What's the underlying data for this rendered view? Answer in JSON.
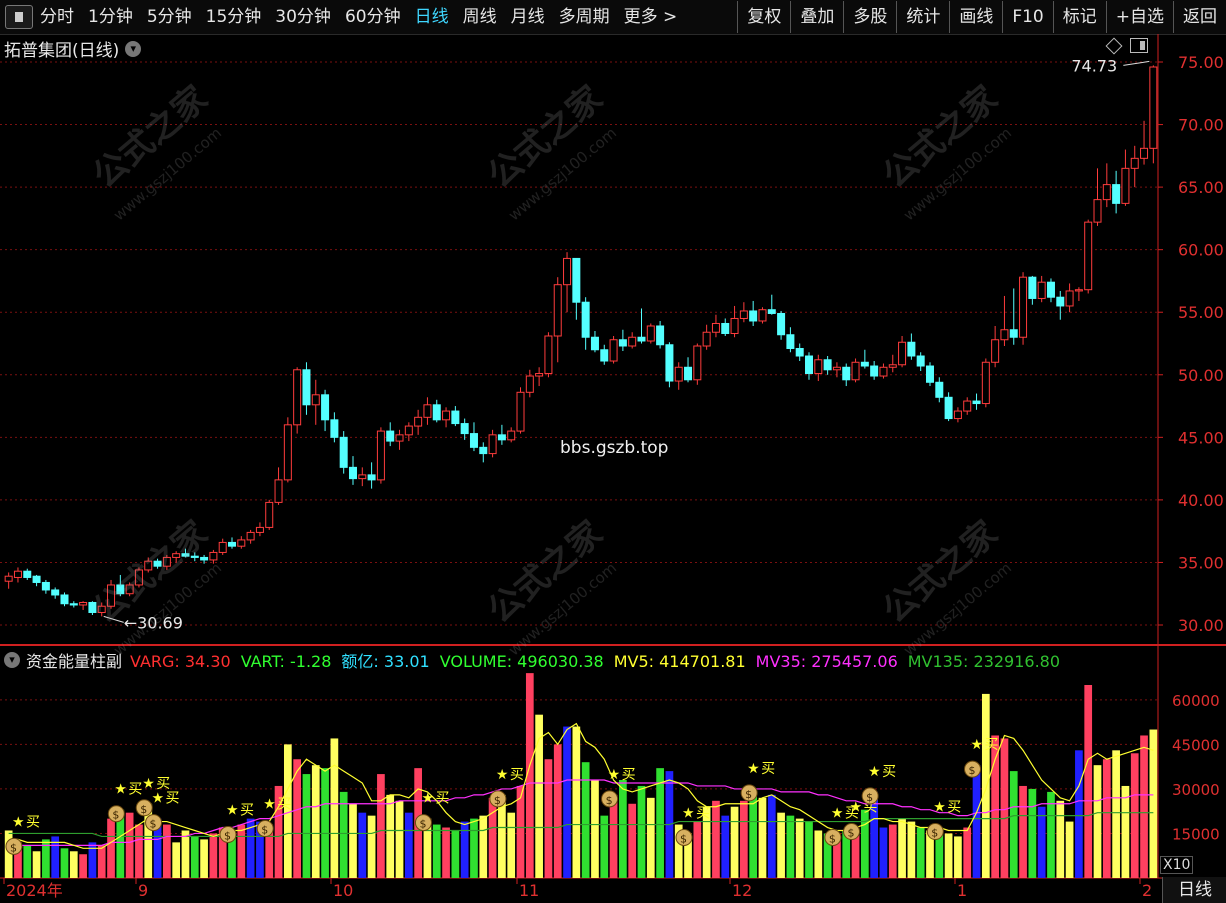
{
  "toolbar": {
    "period_items": [
      "分时",
      "1分钟",
      "5分钟",
      "15分钟",
      "30分钟",
      "60分钟",
      "日线",
      "周线",
      "月线",
      "多周期",
      "更多 >"
    ],
    "active_index": 6,
    "right_buttons": [
      "复权",
      "叠加",
      "多股",
      "统计",
      "画线",
      "F10",
      "标记",
      "+自选",
      "返回"
    ]
  },
  "main_title": "拓普集团(日线)",
  "price_axis": {
    "labels": [
      "75.00",
      "70.00",
      "65.00",
      "60.00",
      "55.00",
      "50.00",
      "45.00",
      "40.00",
      "35.00",
      "30.00"
    ],
    "min": 30,
    "max": 75
  },
  "annotations": {
    "high": "74.73",
    "low": "30.69"
  },
  "overlay_text": "bbs.gszb.top",
  "watermark": {
    "cn": "公式之家",
    "url": "www.gszj100.com"
  },
  "sub_title": {
    "name": "资金能量柱副",
    "items": [
      {
        "label": "VARG: ",
        "value": "34.30",
        "color": "#ff3030"
      },
      {
        "label": "VART: ",
        "value": "-1.28",
        "color": "#30ff30"
      },
      {
        "label": "额亿: ",
        "value": "33.01",
        "color": "#30e0ff"
      },
      {
        "label": "VOLUME: ",
        "value": "496030.38",
        "color": "#30ff30"
      },
      {
        "label": "MV5: ",
        "value": "414701.81",
        "color": "#ffff30"
      },
      {
        "label": "MV35: ",
        "value": "275457.06",
        "color": "#ff30ff"
      },
      {
        "label": "MV135: ",
        "value": "232916.80",
        "color": "#30c030"
      }
    ]
  },
  "volume_axis": {
    "labels": [
      "60000",
      "45000",
      "30000",
      "15000"
    ],
    "max": 65000
  },
  "x_axis": {
    "labels": [
      "2024年",
      "9",
      "10",
      "11",
      "12",
      "1",
      "2"
    ]
  },
  "multiplier": "X10",
  "period_tab": "日线",
  "buy_label": "买",
  "colors": {
    "up": "#ff3c3c",
    "down": "#54ffff",
    "grid": "#7a1010",
    "axis": "#d02020"
  },
  "chart_data": {
    "type": "candlestick+bar",
    "candles": [
      [
        33.5,
        34.2,
        32.9,
        33.9
      ],
      [
        33.8,
        34.6,
        33.4,
        34.3
      ],
      [
        34.3,
        34.5,
        33.6,
        33.8
      ],
      [
        33.9,
        34.0,
        33.1,
        33.4
      ],
      [
        33.4,
        33.6,
        32.5,
        32.8
      ],
      [
        32.8,
        33.0,
        32.1,
        32.4
      ],
      [
        32.4,
        32.6,
        31.5,
        31.7
      ],
      [
        31.7,
        31.9,
        31.4,
        31.6
      ],
      [
        31.6,
        31.9,
        31.2,
        31.8
      ],
      [
        31.8,
        31.9,
        30.8,
        31.0
      ],
      [
        31.0,
        31.8,
        30.69,
        31.5
      ],
      [
        31.5,
        33.6,
        31.3,
        33.2
      ],
      [
        33.2,
        34.0,
        32.3,
        32.5
      ],
      [
        32.5,
        33.4,
        32.3,
        33.2
      ],
      [
        33.2,
        34.6,
        33.0,
        34.4
      ],
      [
        34.4,
        35.4,
        34.2,
        35.1
      ],
      [
        35.1,
        35.3,
        34.5,
        34.7
      ],
      [
        34.7,
        35.6,
        34.4,
        35.4
      ],
      [
        35.4,
        35.9,
        35.0,
        35.7
      ],
      [
        35.7,
        36.1,
        35.4,
        35.5
      ],
      [
        35.5,
        35.8,
        35.1,
        35.4
      ],
      [
        35.4,
        35.6,
        34.9,
        35.2
      ],
      [
        35.2,
        36.0,
        34.9,
        35.8
      ],
      [
        35.8,
        36.9,
        35.6,
        36.6
      ],
      [
        36.6,
        37.0,
        36.1,
        36.3
      ],
      [
        36.3,
        37.1,
        36.1,
        36.8
      ],
      [
        36.8,
        37.6,
        36.5,
        37.4
      ],
      [
        37.4,
        38.2,
        37.1,
        37.8
      ],
      [
        37.8,
        40.0,
        37.6,
        39.8
      ],
      [
        39.8,
        42.6,
        39.6,
        41.6
      ],
      [
        41.6,
        46.6,
        41.4,
        46.0
      ],
      [
        46.0,
        50.6,
        45.3,
        50.4
      ],
      [
        50.4,
        51.0,
        46.8,
        47.6
      ],
      [
        47.6,
        49.6,
        46.0,
        48.4
      ],
      [
        48.4,
        48.8,
        45.5,
        46.4
      ],
      [
        46.4,
        47.0,
        44.6,
        45.0
      ],
      [
        45.0,
        45.5,
        42.1,
        42.6
      ],
      [
        42.6,
        43.5,
        41.2,
        41.7
      ],
      [
        41.7,
        42.6,
        41.1,
        42.0
      ],
      [
        42.0,
        43.0,
        40.9,
        41.6
      ],
      [
        41.6,
        45.8,
        41.3,
        45.5
      ],
      [
        45.5,
        46.2,
        44.3,
        44.7
      ],
      [
        44.7,
        45.6,
        44.0,
        45.2
      ],
      [
        45.2,
        46.2,
        44.7,
        45.9
      ],
      [
        45.9,
        47.2,
        45.2,
        46.6
      ],
      [
        46.6,
        48.2,
        46.0,
        47.6
      ],
      [
        47.6,
        48.0,
        46.2,
        46.4
      ],
      [
        46.4,
        47.4,
        45.8,
        47.1
      ],
      [
        47.1,
        47.5,
        45.9,
        46.1
      ],
      [
        46.1,
        46.5,
        44.8,
        45.3
      ],
      [
        45.3,
        46.2,
        43.9,
        44.2
      ],
      [
        44.2,
        44.6,
        43.0,
        43.7
      ],
      [
        43.7,
        45.6,
        43.4,
        45.2
      ],
      [
        45.2,
        46.0,
        44.4,
        44.8
      ],
      [
        44.8,
        45.8,
        44.6,
        45.5
      ],
      [
        45.5,
        49.0,
        45.3,
        48.6
      ],
      [
        48.6,
        50.4,
        48.2,
        49.9
      ],
      [
        49.9,
        50.6,
        49.1,
        50.1
      ],
      [
        50.1,
        53.4,
        49.8,
        53.1
      ],
      [
        53.1,
        57.8,
        51.0,
        57.2
      ],
      [
        57.2,
        59.8,
        55.0,
        59.3
      ],
      [
        59.3,
        57.1,
        54.4,
        55.8
      ],
      [
        55.8,
        56.2,
        52.0,
        53.0
      ],
      [
        53.0,
        53.5,
        51.8,
        52.0
      ],
      [
        52.0,
        52.4,
        50.8,
        51.1
      ],
      [
        51.1,
        53.1,
        50.9,
        52.8
      ],
      [
        52.8,
        53.6,
        51.9,
        52.3
      ],
      [
        52.3,
        53.4,
        52.1,
        53.0
      ],
      [
        53.0,
        55.3,
        52.5,
        52.7
      ],
      [
        52.7,
        54.1,
        52.5,
        53.9
      ],
      [
        53.9,
        54.3,
        52.1,
        52.4
      ],
      [
        52.4,
        52.6,
        49.0,
        49.5
      ],
      [
        49.5,
        51.0,
        48.8,
        50.6
      ],
      [
        50.6,
        51.4,
        49.4,
        49.6
      ],
      [
        49.6,
        52.5,
        49.2,
        52.3
      ],
      [
        52.3,
        54.0,
        52.0,
        53.4
      ],
      [
        53.4,
        54.8,
        53.0,
        54.1
      ],
      [
        54.1,
        54.5,
        53.1,
        53.3
      ],
      [
        53.3,
        55.5,
        53.0,
        54.5
      ],
      [
        54.5,
        55.8,
        54.2,
        55.1
      ],
      [
        55.1,
        55.9,
        53.9,
        54.3
      ],
      [
        54.3,
        55.4,
        54.1,
        55.2
      ],
      [
        55.2,
        56.4,
        54.8,
        54.9
      ],
      [
        54.9,
        55.1,
        52.8,
        53.2
      ],
      [
        53.2,
        53.8,
        51.8,
        52.1
      ],
      [
        52.1,
        52.5,
        51.1,
        51.5
      ],
      [
        51.5,
        51.8,
        49.6,
        50.1
      ],
      [
        50.1,
        51.6,
        49.5,
        51.2
      ],
      [
        51.2,
        51.5,
        50.0,
        50.4
      ],
      [
        50.4,
        51.0,
        49.8,
        50.6
      ],
      [
        50.6,
        50.9,
        49.1,
        49.6
      ],
      [
        49.6,
        51.3,
        49.4,
        51.0
      ],
      [
        51.0,
        52.0,
        50.5,
        50.7
      ],
      [
        50.7,
        51.1,
        49.6,
        49.9
      ],
      [
        49.9,
        50.9,
        49.7,
        50.6
      ],
      [
        50.6,
        51.6,
        50.2,
        50.8
      ],
      [
        50.8,
        53.1,
        50.6,
        52.6
      ],
      [
        52.6,
        53.3,
        51.2,
        51.5
      ],
      [
        51.5,
        51.8,
        50.3,
        50.7
      ],
      [
        50.7,
        51.0,
        49.1,
        49.4
      ],
      [
        49.4,
        49.8,
        47.8,
        48.2
      ],
      [
        48.2,
        48.6,
        46.3,
        46.5
      ],
      [
        46.5,
        47.4,
        46.2,
        47.1
      ],
      [
        47.1,
        48.2,
        46.8,
        47.9
      ],
      [
        47.9,
        48.5,
        47.2,
        47.7
      ],
      [
        47.7,
        51.3,
        47.4,
        51.0
      ],
      [
        51.0,
        53.9,
        50.6,
        52.8
      ],
      [
        52.8,
        56.3,
        52.3,
        53.6
      ],
      [
        53.6,
        56.9,
        52.4,
        53.0
      ],
      [
        53.0,
        58.2,
        52.4,
        57.8
      ],
      [
        57.8,
        57.9,
        55.6,
        56.1
      ],
      [
        56.1,
        57.9,
        55.8,
        57.4
      ],
      [
        57.4,
        57.7,
        55.8,
        56.2
      ],
      [
        56.2,
        56.7,
        54.4,
        55.5
      ],
      [
        55.5,
        57.3,
        55.0,
        56.7
      ],
      [
        56.7,
        57.0,
        55.9,
        56.8
      ],
      [
        56.8,
        62.4,
        56.5,
        62.2
      ],
      [
        62.2,
        66.5,
        61.9,
        64.0
      ],
      [
        64.0,
        66.9,
        63.4,
        65.2
      ],
      [
        65.2,
        66.3,
        62.9,
        63.7
      ],
      [
        63.7,
        68.0,
        63.5,
        66.5
      ],
      [
        66.5,
        68.3,
        65.0,
        67.3
      ],
      [
        67.3,
        70.3,
        66.8,
        68.1
      ],
      [
        68.1,
        74.73,
        66.9,
        74.6
      ]
    ],
    "volumes": [
      16,
      12,
      11,
      9,
      13,
      14,
      10,
      9,
      8,
      12,
      11,
      20,
      23,
      22,
      18,
      25,
      20,
      18,
      12,
      16,
      14,
      13,
      15,
      17,
      16,
      18,
      20,
      19,
      18,
      31,
      45,
      40,
      35,
      38,
      37,
      47,
      29,
      25,
      22,
      21,
      35,
      28,
      26,
      22,
      37,
      20,
      18,
      17,
      16,
      19,
      20,
      21,
      27,
      28,
      22,
      31,
      69,
      55,
      40,
      45,
      51,
      51,
      39,
      33,
      21,
      28,
      33,
      25,
      31,
      27,
      37,
      36,
      18,
      15,
      19,
      24,
      26,
      21,
      24,
      26,
      30,
      27,
      28,
      22,
      21,
      20,
      19,
      16,
      15,
      15,
      16,
      17,
      23,
      29,
      17,
      18,
      20,
      19,
      17,
      16,
      17,
      15,
      14,
      17,
      38,
      62,
      48,
      47,
      36,
      31,
      30,
      24,
      29,
      26,
      19,
      43,
      65,
      38,
      40,
      43,
      31,
      42,
      48,
      50
    ],
    "mv5": [
      13,
      13,
      12,
      12,
      12,
      12,
      12,
      11,
      10,
      10,
      10,
      12,
      14,
      16,
      18,
      20,
      19,
      19,
      18,
      17,
      16,
      15,
      14,
      15,
      16,
      16,
      17,
      18,
      19,
      24,
      30,
      36,
      40,
      38,
      36,
      38,
      36,
      34,
      32,
      26,
      26,
      28,
      28,
      27,
      30,
      29,
      26,
      22,
      19,
      18,
      19,
      20,
      22,
      24,
      25,
      27,
      38,
      47,
      49,
      45,
      50,
      52,
      46,
      44,
      40,
      33,
      30,
      29,
      30,
      31,
      32,
      33,
      32,
      30,
      26,
      24,
      24,
      25,
      25,
      25,
      25,
      27,
      28,
      26,
      24,
      23,
      21,
      19,
      17,
      16,
      16,
      17,
      18,
      20,
      20,
      19,
      19,
      18,
      17,
      17,
      17,
      16,
      16,
      16,
      22,
      30,
      40,
      48,
      47,
      43,
      38,
      33,
      30,
      27,
      26,
      31,
      40,
      42,
      40,
      41,
      42,
      43,
      44,
      43
    ],
    "mv35": [
      11,
      11,
      11,
      11,
      11,
      11,
      11,
      11,
      11,
      11,
      11,
      12,
      12,
      12,
      13,
      13,
      13,
      14,
      14,
      14,
      15,
      15,
      16,
      17,
      17,
      18,
      19,
      20,
      20,
      21,
      22,
      23,
      24,
      24,
      25,
      25,
      25,
      25,
      25,
      25,
      25,
      25,
      26,
      26,
      26,
      26,
      26,
      26,
      27,
      27,
      28,
      28,
      29,
      30,
      30,
      31,
      32,
      32,
      32,
      32,
      33,
      33,
      33,
      33,
      33,
      32,
      32,
      32,
      32,
      32,
      32,
      32,
      32,
      32,
      31,
      31,
      31,
      31,
      30,
      30,
      30,
      30,
      30,
      29,
      29,
      29,
      29,
      28,
      28,
      27,
      26,
      26,
      25,
      25,
      25,
      25,
      24,
      24,
      23,
      23,
      22,
      22,
      21,
      21,
      22,
      22,
      23,
      23,
      24,
      24,
      24,
      25,
      25,
      25,
      25,
      26,
      26,
      26,
      27,
      27,
      27,
      28,
      28,
      28
    ],
    "mv135": [
      15,
      15,
      15,
      15,
      15,
      15,
      15,
      15,
      15,
      15,
      14,
      14,
      14,
      14,
      14,
      14,
      14,
      14,
      14,
      14,
      14,
      14,
      14,
      14,
      14,
      14,
      14,
      14,
      14,
      14,
      15,
      15,
      15,
      15,
      15,
      15,
      15,
      15,
      15,
      15,
      16,
      16,
      16,
      16,
      16,
      16,
      16,
      16,
      16,
      16,
      16,
      16,
      17,
      17,
      17,
      17,
      17,
      17,
      17,
      17,
      18,
      18,
      18,
      18,
      18,
      18,
      18,
      18,
      18,
      18,
      18,
      18,
      19,
      19,
      19,
      19,
      19,
      19,
      19,
      19,
      19,
      19,
      19,
      19,
      19,
      19,
      19,
      19,
      19,
      19,
      19,
      19,
      19,
      20,
      20,
      20,
      20,
      20,
      20,
      20,
      20,
      20,
      20,
      20,
      20,
      20,
      20,
      20,
      21,
      21,
      21,
      21,
      21,
      21,
      21,
      21,
      21,
      22,
      22,
      22,
      22,
      22,
      22,
      22
    ],
    "buy_markers": [
      1,
      12,
      15,
      16,
      24,
      28,
      45,
      53,
      65,
      73,
      80,
      89,
      91,
      93,
      100,
      104
    ]
  }
}
